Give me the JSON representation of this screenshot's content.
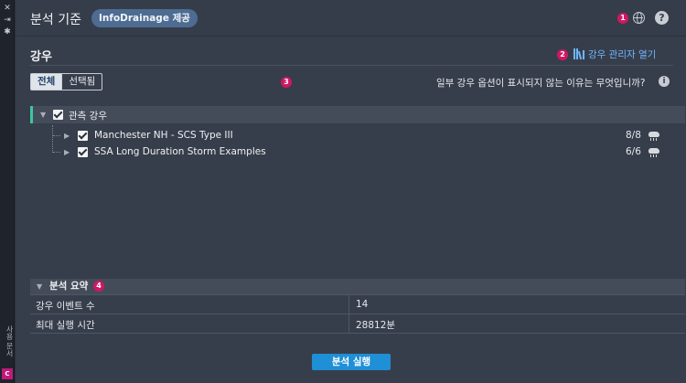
{
  "rail": {
    "close": "✕",
    "collapse": "⇥",
    "settings": "✱",
    "vertical_label": "사용 문서",
    "brand": "C"
  },
  "header": {
    "title": "분석 기준",
    "chip": "InfoDrainage 제공",
    "badge": "1"
  },
  "section": {
    "title": "강우",
    "manager_link": "강우 관리자 열기",
    "badge": "2"
  },
  "filter": {
    "tabs": [
      "전체",
      "선택됨"
    ],
    "selected": "전체",
    "badge": "3"
  },
  "hint": {
    "text": "일부 강우 옵션이 표시되지 않는 이유는 무엇입니까?"
  },
  "tree": {
    "group": {
      "label": "관측 강우",
      "checked": true
    },
    "items": [
      {
        "label": "Manchester NH - SCS Type III",
        "count": "8/8",
        "checked": true
      },
      {
        "label": "SSA Long Duration Storm Examples",
        "count": "6/6",
        "checked": true
      }
    ]
  },
  "summary": {
    "title": "분석 요약",
    "badge": "4",
    "rows": [
      {
        "key": "강우 이벤트 수",
        "value": "14"
      },
      {
        "key": "최대 실행 시간",
        "value": "28812분"
      }
    ]
  },
  "actions": {
    "run": "분석 실행"
  },
  "colors": {
    "accent": "#1f8fd6",
    "badge": "#d01764",
    "link": "#6fb6ff",
    "chip": "#4e6c92",
    "group_marker": "#3fc59c"
  }
}
